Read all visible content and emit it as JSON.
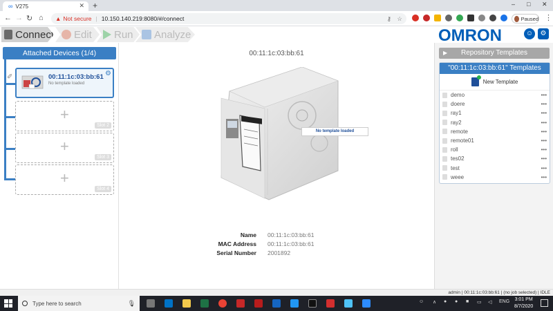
{
  "browser": {
    "tab_title": "V275",
    "new_tab": "+",
    "not_secure": "Not secure",
    "url": "10.150.140.219:8080/#/connect",
    "profile": "Paused"
  },
  "steps": {
    "connect": "Connect",
    "edit": "Edit",
    "run": "Run",
    "analyze": "Analyze"
  },
  "brand": {
    "logo": "OMRON"
  },
  "left": {
    "header": "Attached Devices (1/4)",
    "device": {
      "id": "00:11:1c:03:bb:61",
      "sub": "No template loaded"
    },
    "slots": [
      "Slot 2",
      "Slot 3",
      "Slot 4"
    ]
  },
  "center": {
    "title": "00:11:1c:03:bb:61",
    "overlay": "No template loaded",
    "info": [
      {
        "k": "Name",
        "v": "00:11:1c:03:bb:61"
      },
      {
        "k": "MAC Address",
        "v": "00:11:1c:03:bb:61"
      },
      {
        "k": "Serial Number",
        "v": "2001892"
      }
    ]
  },
  "right": {
    "repo_header": "Repository Templates",
    "templates_header": "\"00:11:1c:03:bb:61\" Templates",
    "new_template": "New Template",
    "templates": [
      "demo",
      "doere",
      "ray1",
      "ray2",
      "remote",
      "remote01",
      "roll",
      "tes02",
      "test",
      "weee"
    ]
  },
  "status": {
    "text": "admin | 00:11:1c:03:bb:61 | (no job selected) | IDLE"
  },
  "taskbar": {
    "search_placeholder": "Type here to search",
    "lang": "ENG",
    "time": "3:01 PM",
    "date": "8/7/2020"
  }
}
